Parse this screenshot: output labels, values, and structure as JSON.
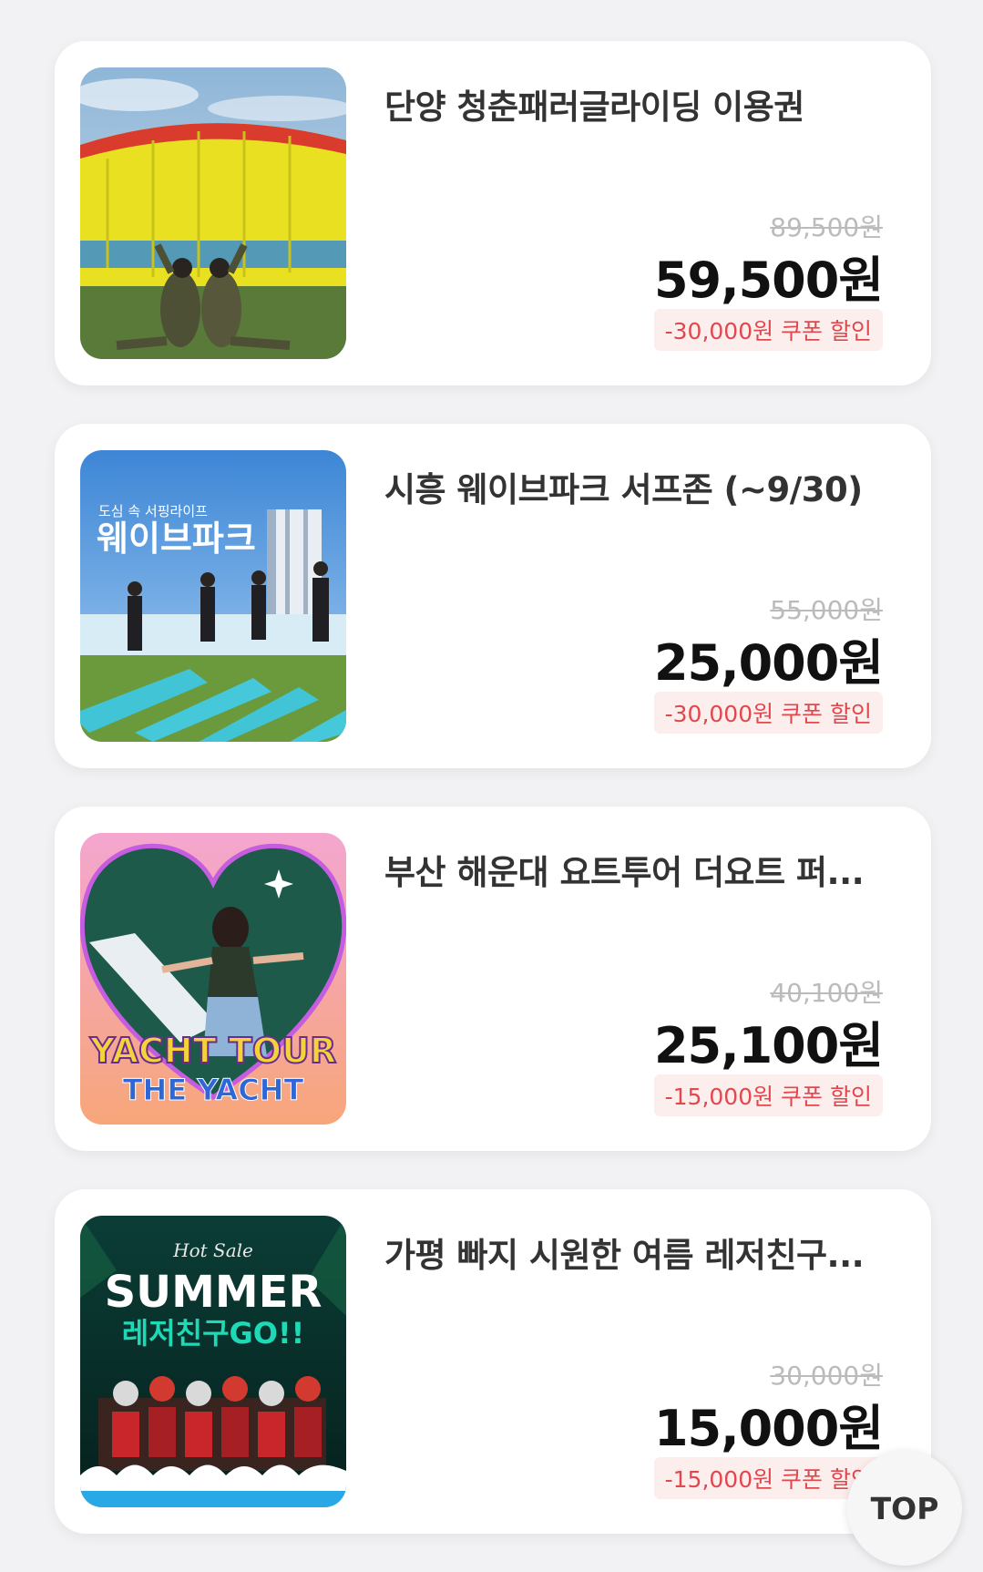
{
  "products": [
    {
      "title": "단양 청춘패러글라이딩 이용권",
      "original_price": "89,500원",
      "price": "59,500원",
      "coupon": "-30,000원 쿠폰 할인",
      "image": "paragliding-photo"
    },
    {
      "title": "시흥 웨이브파크 서프존 (~9/30)",
      "original_price": "55,000원",
      "price": "25,000원",
      "coupon": "-30,000원 쿠폰 할인",
      "image": "surfing-photo",
      "image_text": {
        "small": "도심 속 서핑라이프",
        "large": "웨이브파크"
      }
    },
    {
      "title": "부산 해운대 요트투어 더요트 퍼...",
      "original_price": "40,100원",
      "price": "25,100원",
      "coupon": "-15,000원 쿠폰 할인",
      "image": "yacht-tour-photo",
      "image_text": {
        "line1": "YACHT TOUR",
        "line2": "THE YACHT"
      }
    },
    {
      "title": "가평 빠지 시원한 여름 레저친구...",
      "original_price": "30,000원",
      "price": "15,000원",
      "coupon": "-15,000원 쿠폰 할인",
      "image": "summer-leisure-photo",
      "image_text": {
        "script": "Hot Sale",
        "headline": "SUMMER",
        "sub": "레저친구GO!!"
      }
    }
  ],
  "top_button": "TOP",
  "colors": {
    "background": "#f2f2f4",
    "card": "#ffffff",
    "coupon_bg": "#fdeeee",
    "coupon_text": "#e0484e",
    "strike_price": "#bbbbbb"
  }
}
